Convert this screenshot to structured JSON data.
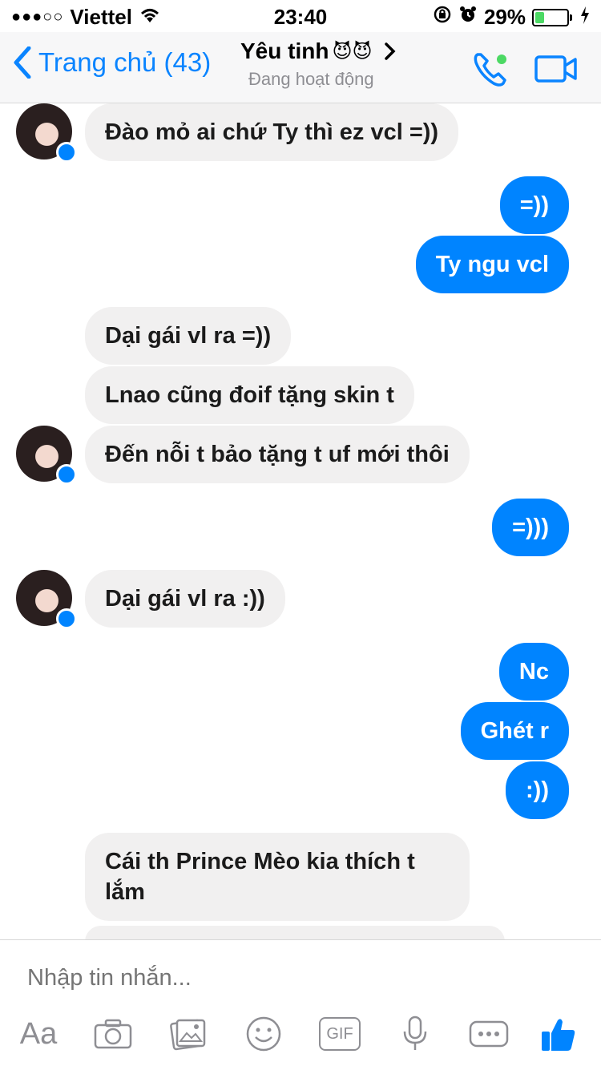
{
  "status": {
    "carrier": "Viettel",
    "signal": "●●●○○",
    "time": "23:40",
    "battery": "29%",
    "battery_level": 0.29
  },
  "nav": {
    "back_label": "Trang chủ (43)",
    "contact_name": "Yêu tinh",
    "contact_emoji": "😈😈",
    "status_text": "Đang hoạt động"
  },
  "messages": [
    {
      "side": "in",
      "text": "Đào mỏ ai chứ Ty thì ez vcl =))"
    },
    {
      "side": "out",
      "text": "=))"
    },
    {
      "side": "out",
      "text": "Ty ngu vcl"
    },
    {
      "side": "in",
      "text": "Dại gái vl ra =))"
    },
    {
      "side": "in",
      "text": "Lnao cũng đoif tặng skin t"
    },
    {
      "side": "in",
      "text": "Đến nỗi t bảo tặng t uf mới thôi"
    },
    {
      "side": "out",
      "text": "=)))"
    },
    {
      "side": "in",
      "text": "Dại gái vl ra :))"
    },
    {
      "side": "out",
      "text": "Nc"
    },
    {
      "side": "out",
      "text": "Ghét r"
    },
    {
      "side": "out",
      "text": ":))"
    },
    {
      "side": "in",
      "text": "Cái th Prince Mèo kia thích t\nlắm"
    }
  ],
  "composer": {
    "placeholder": "Nhập tin nhắn...",
    "text_tool": "Aa",
    "gif_label": "GIF"
  },
  "colors": {
    "accent": "#0084ff",
    "incoming_bubble": "#f1f0f0",
    "online": "#4cd964"
  },
  "icons": [
    "wifi-icon",
    "lock-rotation-icon",
    "alarm-icon",
    "battery-icon",
    "charging-icon",
    "back-chevron-icon",
    "chevron-right-icon",
    "phone-icon",
    "video-icon",
    "messenger-badge-icon",
    "camera-icon",
    "image-icon",
    "emoji-icon",
    "mic-icon",
    "more-icon",
    "like-icon"
  ]
}
